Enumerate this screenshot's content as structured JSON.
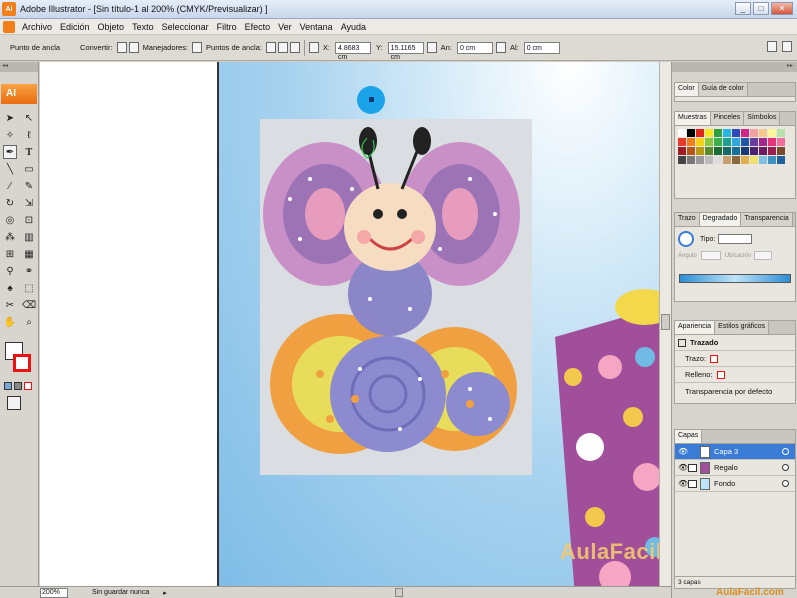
{
  "window": {
    "title": "Adobe Illustrator - [Sin título-1 al 200% (CMYK/Previsualizar) ]",
    "minimize": "_",
    "maximize": "□",
    "close": "✕"
  },
  "app_logo_text": "Ai",
  "menu": [
    "Archivo",
    "Edición",
    "Objeto",
    "Texto",
    "Seleccionar",
    "Filtro",
    "Efecto",
    "Ver",
    "Ventana",
    "Ayuda"
  ],
  "control": {
    "anchor_label": "Punto de ancla",
    "convert_label": "Convertir:",
    "handles_label": "Manejadores:",
    "anchors_label": "Puntos de ancla:",
    "x_label": "X:",
    "x_value": "4.8683 cm",
    "y_label": "Y:",
    "y_value": "15.1165 cm",
    "w_label": "An:",
    "w_value": "0 cm",
    "h_label": "Al:",
    "h_value": "0 cm"
  },
  "tools": {
    "badge": "AI",
    "items": [
      "select-arrow-icon",
      "direct-select-icon",
      "magic-wand-icon",
      "lasso-icon",
      "pen-icon",
      "type-icon",
      "line-icon",
      "rectangle-icon",
      "paintbrush-icon",
      "pencil-icon",
      "rotate-icon",
      "scale-icon",
      "warp-icon",
      "free-transform-icon",
      "symbol-sprayer-icon",
      "graph-icon",
      "mesh-icon",
      "gradient-icon",
      "eyedropper-icon",
      "blend-icon",
      "live-paint-icon",
      "live-paint-select-icon",
      "slice-icon",
      "eraser-icon",
      "hand-icon",
      "zoom-icon"
    ]
  },
  "panels": {
    "color_tabs": [
      "Color",
      "Guía de color"
    ],
    "swatch_tabs": [
      "Muestras",
      "Pinceles",
      "Símbolos"
    ],
    "stroke_tabs": [
      "Trazo",
      "Degradado",
      "Transparencia"
    ],
    "gradient": {
      "type_label": "Tipo:",
      "angle_label": "Ángulo",
      "location_label": "Ubicación"
    },
    "appearance_tabs": [
      "Apariencia",
      "Estilos gráficos"
    ],
    "appearance": {
      "title": "Trazado",
      "stroke_label": "Trazo:",
      "fill_label": "Relleno:",
      "opacity_label": "Transparencia por defecto"
    },
    "layers_tabs": [
      "Capas"
    ],
    "layers": [
      {
        "name": "Capa 3",
        "selected": true
      },
      {
        "name": "Regalo",
        "selected": false
      },
      {
        "name": "Fondo",
        "selected": false
      }
    ],
    "layers_count": "3 capas"
  },
  "status": {
    "zoom": "200%",
    "save_state": "Sin guardar nunca"
  },
  "watermark": "AulaFacil.com",
  "watermark_small": "AulaFacil.com",
  "colors": {
    "accent": "#f07f1c",
    "layer_selected": "#3a7bd5",
    "anchor_blue": "#1aa3e8"
  }
}
